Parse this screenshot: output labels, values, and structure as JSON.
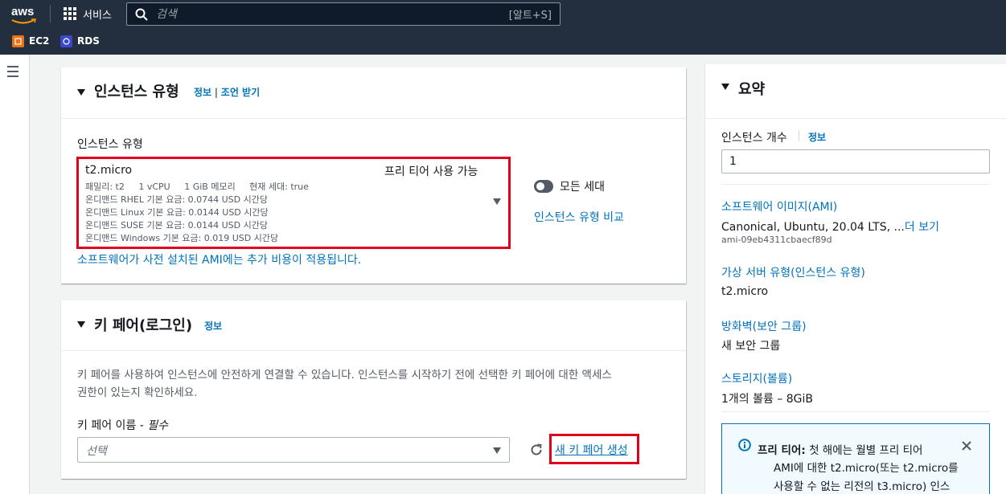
{
  "nav": {
    "logo_text": "aws",
    "services_label": "서비스",
    "search_placeholder": "검색",
    "search_shortcut": "[알트+S]",
    "favorites": [
      {
        "label": "EC2",
        "color": "#ec7211"
      },
      {
        "label": "RDS",
        "color": "#3b48cc"
      }
    ]
  },
  "instance_type": {
    "title": "인스턴스 유형",
    "info_link": "정보",
    "divider": "|",
    "advice_link": "조언 받기",
    "field_label": "인스턴스 유형",
    "selected": {
      "name": "t2.micro",
      "free_tier": "프리 티어 사용 가능",
      "specs": "패밀리: t2     1 vCPU     1 GiB 메모리     현재 세대: true",
      "pricing": [
        "온디맨드 RHEL 기본 요금: 0.0744 USD 시간당",
        "온디맨드 Linux 기본 요금: 0.0144 USD 시간당",
        "온디맨드 SUSE 기본 요금: 0.0144 USD 시간당",
        "온디맨드 Windows 기본 요금: 0.019 USD 시간당"
      ]
    },
    "all_generations_label": "모든 세대",
    "compare_link": "인스턴스 유형 비교",
    "ami_note_link": "소프트웨어가 사전 설치된 AMI에는 추가 비용이 적용됩니다."
  },
  "key_pair": {
    "title": "키 페어(로그인)",
    "info_link": "정보",
    "description_line1": "키 페어를 사용하여 인스턴스에 안전하게 연결할 수 있습니다. 인스턴스를 시작하기 전에 선택한 키 페어에 대한 액세스",
    "description_line2": "권한이 있는지 확인하세요.",
    "name_label": "키 페어 이름 - ",
    "required_label": "필수",
    "select_placeholder": "선택",
    "create_link": "새 키 페어 생성"
  },
  "summary": {
    "title": "요약",
    "instance_count_label": "인스턴스 개수",
    "instance_count_info": "정보",
    "instance_count_value": "1",
    "ami_link": "소프트웨어 이미지(AMI)",
    "ami_value": "Canonical, Ubuntu, 20.04 LTS, ...",
    "ami_more_link": "더 보기",
    "ami_id": "ami-09eb4311cbaecf89d",
    "instance_type_link": "가상 서버 유형(인스턴스 유형)",
    "instance_type_value": "t2.micro",
    "firewall_link": "방화벽(보안 그룹)",
    "firewall_value": "새 보안 그룹",
    "storage_link": "스토리지(볼륨)",
    "storage_value": "1개의 볼륨 – 8GiB",
    "free_tier_title": "프리 티어:",
    "free_tier_line1": " 첫 해에는 월별 프리 티어",
    "free_tier_line2": "AMI에 대한 t2.micro(또는 t2.micro를",
    "free_tier_line3": "사용할 수 없는 리전의 t3.micro) 인스"
  },
  "colors": {
    "nav_bg": "#232f3e",
    "link": "#0073bb",
    "highlight": "#e0001b"
  }
}
